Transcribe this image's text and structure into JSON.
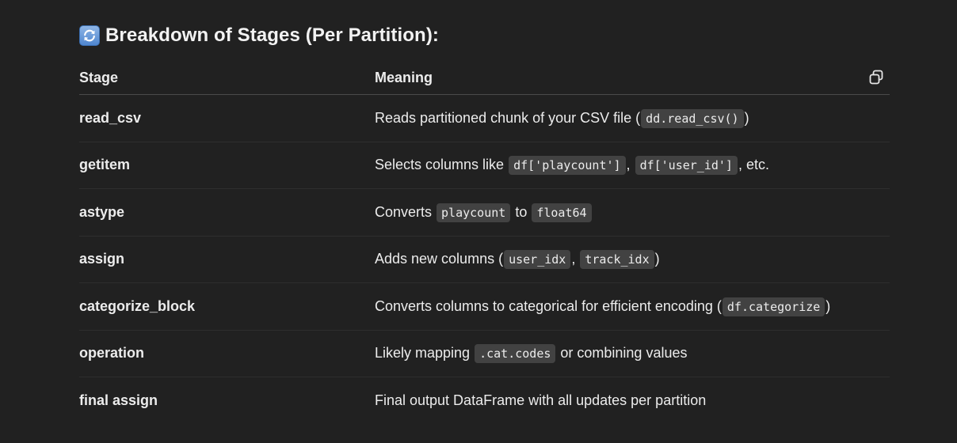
{
  "heading": {
    "icon": "refresh-arrows-icon",
    "title": "Breakdown of Stages (Per Partition):"
  },
  "table": {
    "headers": [
      "Stage",
      "Meaning"
    ],
    "rows": [
      {
        "stage": "read_csv",
        "parts": [
          {
            "t": "Reads partitioned chunk of your CSV file ("
          },
          {
            "c": "dd.read_csv()"
          },
          {
            "t": ")"
          }
        ]
      },
      {
        "stage": "getitem",
        "parts": [
          {
            "t": "Selects columns like "
          },
          {
            "c": "df['playcount']"
          },
          {
            "t": ", "
          },
          {
            "c": "df['user_id']"
          },
          {
            "t": ", etc."
          }
        ]
      },
      {
        "stage": "astype",
        "parts": [
          {
            "t": "Converts "
          },
          {
            "c": "playcount"
          },
          {
            "t": " to "
          },
          {
            "c": "float64"
          }
        ]
      },
      {
        "stage": "assign",
        "parts": [
          {
            "t": "Adds new columns ("
          },
          {
            "c": "user_idx"
          },
          {
            "t": ", "
          },
          {
            "c": "track_idx"
          },
          {
            "t": ")"
          }
        ]
      },
      {
        "stage": "categorize_block",
        "parts": [
          {
            "t": "Converts columns to categorical for efficient encoding ("
          },
          {
            "c": "df.categorize"
          },
          {
            "t": ")"
          }
        ]
      },
      {
        "stage": "operation",
        "parts": [
          {
            "t": "Likely mapping "
          },
          {
            "c": ".cat.codes"
          },
          {
            "t": " or combining values"
          }
        ]
      },
      {
        "stage": "final assign",
        "parts": [
          {
            "t": "Final output DataFrame with all updates per partition"
          }
        ]
      }
    ],
    "copy_icon": "copy-icon"
  }
}
